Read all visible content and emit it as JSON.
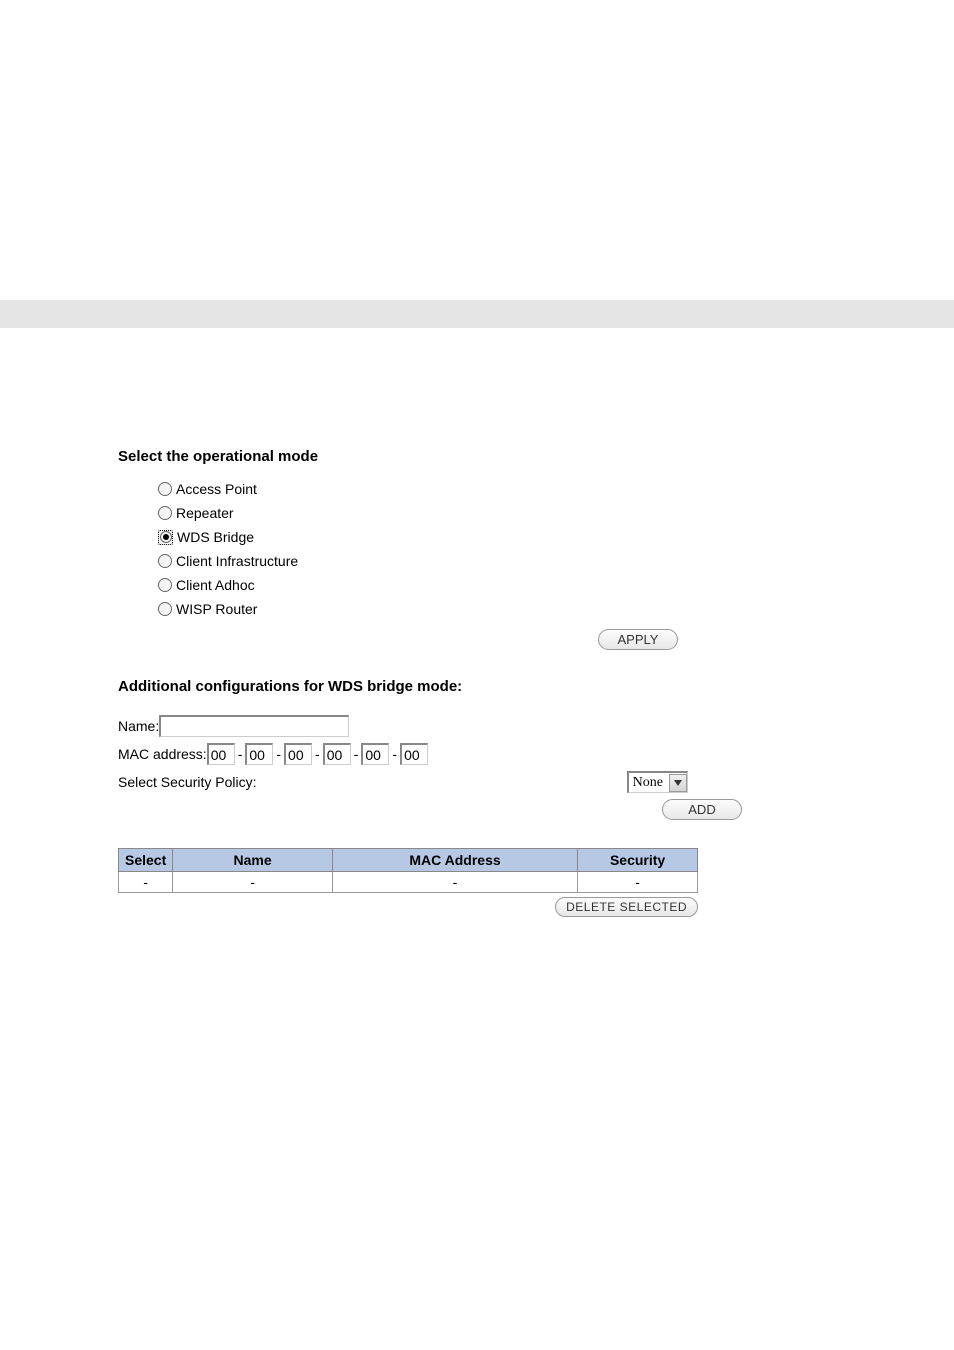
{
  "operationalMode": {
    "heading": "Select the operational mode",
    "options": [
      {
        "label": "Access Point",
        "selected": false
      },
      {
        "label": "Repeater",
        "selected": false
      },
      {
        "label": "WDS Bridge",
        "selected": true
      },
      {
        "label": "Client Infrastructure",
        "selected": false
      },
      {
        "label": "Client Adhoc",
        "selected": false
      },
      {
        "label": "WISP Router",
        "selected": false
      }
    ],
    "applyLabel": "APPLY"
  },
  "wdsConfig": {
    "heading": "Additional configurations for WDS bridge mode:",
    "nameLabel": "Name:",
    "nameValue": "",
    "macLabel": "MAC address:",
    "macParts": [
      "00",
      "00",
      "00",
      "00",
      "00",
      "00"
    ],
    "macSep": "-",
    "securityLabel": "Select Security Policy:",
    "securitySelected": "None",
    "addLabel": "ADD"
  },
  "wdsTable": {
    "headers": {
      "select": "Select",
      "name": "Name",
      "mac": "MAC Address",
      "security": "Security"
    },
    "rows": [
      {
        "select": "-",
        "name": "-",
        "mac": "-",
        "security": "-"
      }
    ],
    "deleteLabel": "DELETE SELECTED"
  }
}
